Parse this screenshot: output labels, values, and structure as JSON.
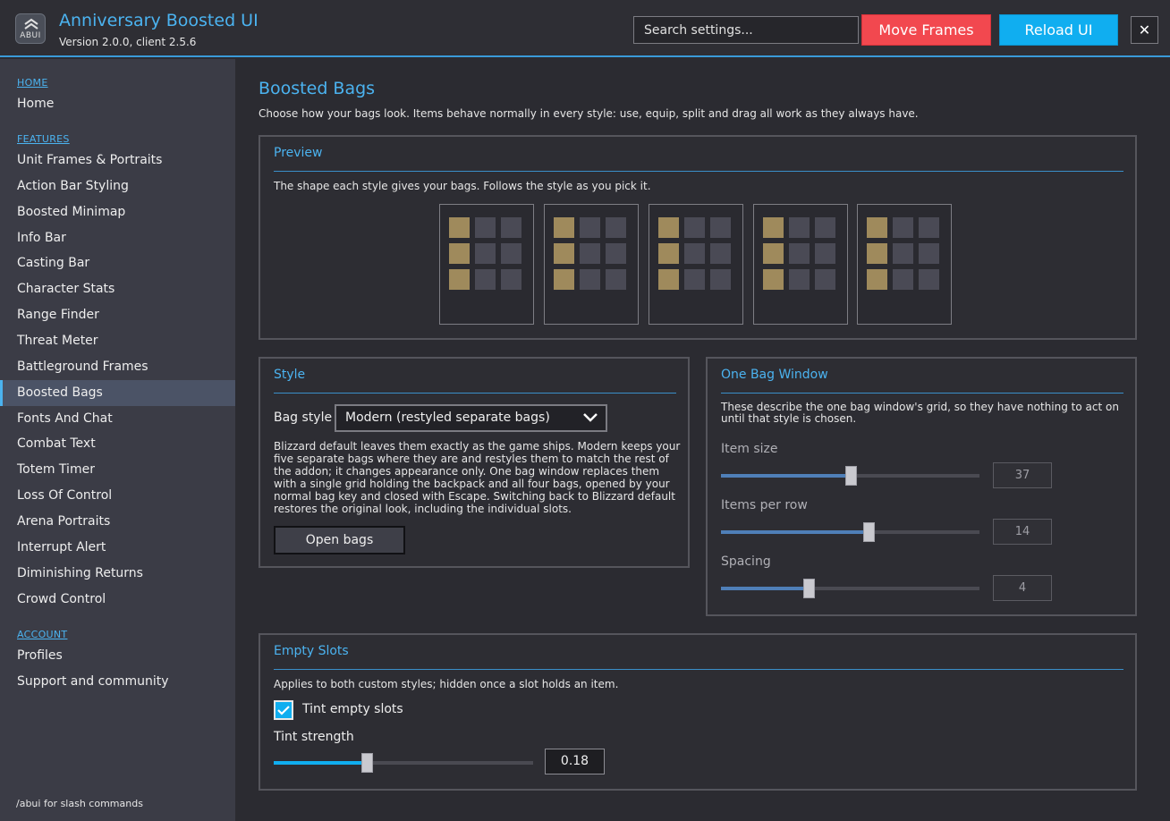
{
  "header": {
    "logo_text": "ABUI",
    "title": "Anniversary Boosted UI",
    "version": "Version 2.0.0, client 2.5.6",
    "search_placeholder": "Search settings...",
    "move_frames": "Move Frames",
    "reload_ui": "Reload UI",
    "close": "✕"
  },
  "sidebar": {
    "sections": {
      "home": "HOME",
      "features": "FEATURES",
      "account": "ACCOUNT"
    },
    "home_items": [
      "Home"
    ],
    "feature_items": [
      "Unit Frames & Portraits",
      "Action Bar Styling",
      "Boosted Minimap",
      "Info Bar",
      "Casting Bar",
      "Character Stats",
      "Range Finder",
      "Threat Meter",
      "Battleground Frames",
      "Boosted Bags",
      "Fonts And Chat",
      "Combat Text",
      "Totem Timer",
      "Loss Of Control",
      "Arena Portraits",
      "Interrupt Alert",
      "Diminishing Returns",
      "Crowd Control"
    ],
    "active": "Boosted Bags",
    "account_items": [
      "Profiles",
      "Support and community"
    ],
    "footer": "/abui for slash commands"
  },
  "main": {
    "title": "Boosted Bags",
    "description": "Choose how your bags look.  Items behave normally in every style: use, equip, split and drag all work as they always have.",
    "preview": {
      "title": "Preview",
      "description": "The shape each style gives your bags.  Follows the style as you pick it."
    },
    "style": {
      "title": "Style",
      "bag_style_label": "Bag style",
      "bag_style_value": "Modern (restyled separate bags)",
      "description": "Blizzard default leaves them exactly as the game ships.  Modern keeps your five separate bags where they are and restyles them to match the rest of the addon; it changes appearance only.  One bag window replaces them with a single grid holding the backpack and all four bags, opened by your normal bag key and closed with Escape.  Switching back to Blizzard default restores the original look, including the individual slots.",
      "open_bags": "Open bags"
    },
    "one_bag": {
      "title": "One Bag Window",
      "description": "These describe the one bag window's grid, so they have nothing to act on until that style is chosen.",
      "item_size_label": "Item size",
      "item_size_value": "37",
      "items_per_row_label": "Items per row",
      "items_per_row_value": "14",
      "spacing_label": "Spacing",
      "spacing_value": "4"
    },
    "empty_slots": {
      "title": "Empty Slots",
      "description": "Applies to both custom styles; hidden once a slot holds an item.",
      "tint_label": "Tint empty slots",
      "tint_checked": true,
      "tint_strength_label": "Tint strength",
      "tint_strength_value": "0.18"
    }
  },
  "sliders": {
    "item_size": 0.5,
    "items_per_row": 0.57,
    "spacing": 0.34,
    "tint_strength": 0.36
  },
  "colors": {
    "accent": "#4bb3f0",
    "move_frames": "#f2484f",
    "reload_ui": "#10aef0",
    "slot_gold": "#9f8a5c",
    "slot_dark": "#4a4a55",
    "slider_fill_muted": "#4f7fb8",
    "slider_fill_active": "#10aef0"
  }
}
